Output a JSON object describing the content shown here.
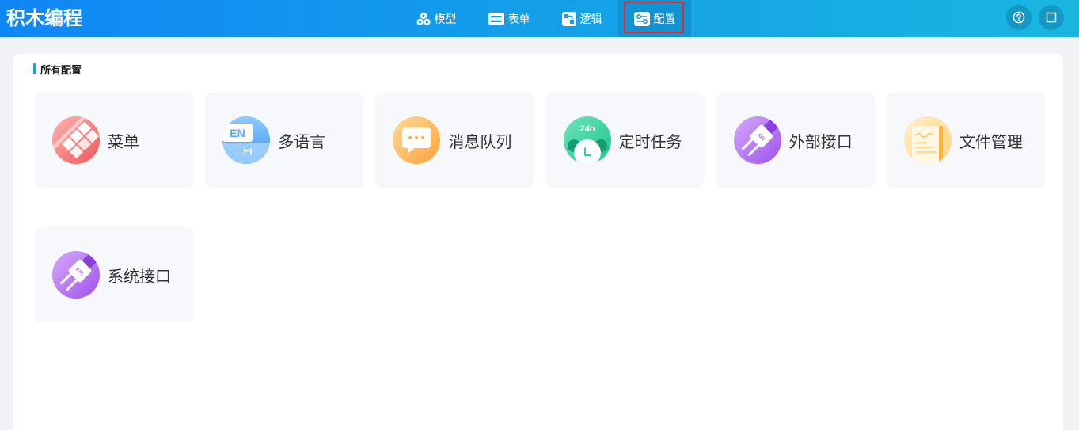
{
  "colors": {
    "header_start": "#0f86f6",
    "header_mid": "#149fe9",
    "header_end": "#1ab6e0",
    "accent": "#1a9fe8",
    "page_bg": "#f0f2f5",
    "card_bg": "#f7f8fc",
    "highlight": "#e2262c"
  },
  "header": {
    "app_title": "积木编程",
    "nav": [
      {
        "label": "模型",
        "icon": "cubes-icon",
        "active": false
      },
      {
        "label": "表单",
        "icon": "form-icon",
        "active": false
      },
      {
        "label": "逻辑",
        "icon": "logic-icon",
        "active": false
      },
      {
        "label": "配置",
        "icon": "config-icon",
        "active": true
      }
    ],
    "actions": [
      {
        "icon": "help-icon"
      },
      {
        "icon": "maximize-icon"
      }
    ]
  },
  "main": {
    "section_title": "所有配置",
    "cards": [
      {
        "label": "菜单",
        "icon": "menu-icon",
        "color": "#f56b6b"
      },
      {
        "label": "多语言",
        "icon": "language-icon",
        "icon_text": "EN",
        "color": "#4aa2f2"
      },
      {
        "label": "消息队列",
        "icon": "message-icon",
        "color": "#ffab45"
      },
      {
        "label": "定时任务",
        "icon": "clock-icon",
        "icon_text": "24h",
        "color": "#2ccf98"
      },
      {
        "label": "外部接口",
        "icon": "plug-icon",
        "icon_text": "API",
        "color": "#a65cec"
      },
      {
        "label": "文件管理",
        "icon": "file-icon",
        "color": "#ffd27a"
      },
      {
        "label": "系统接口",
        "icon": "plug-icon",
        "icon_text": "API",
        "color": "#a65cec"
      }
    ]
  }
}
